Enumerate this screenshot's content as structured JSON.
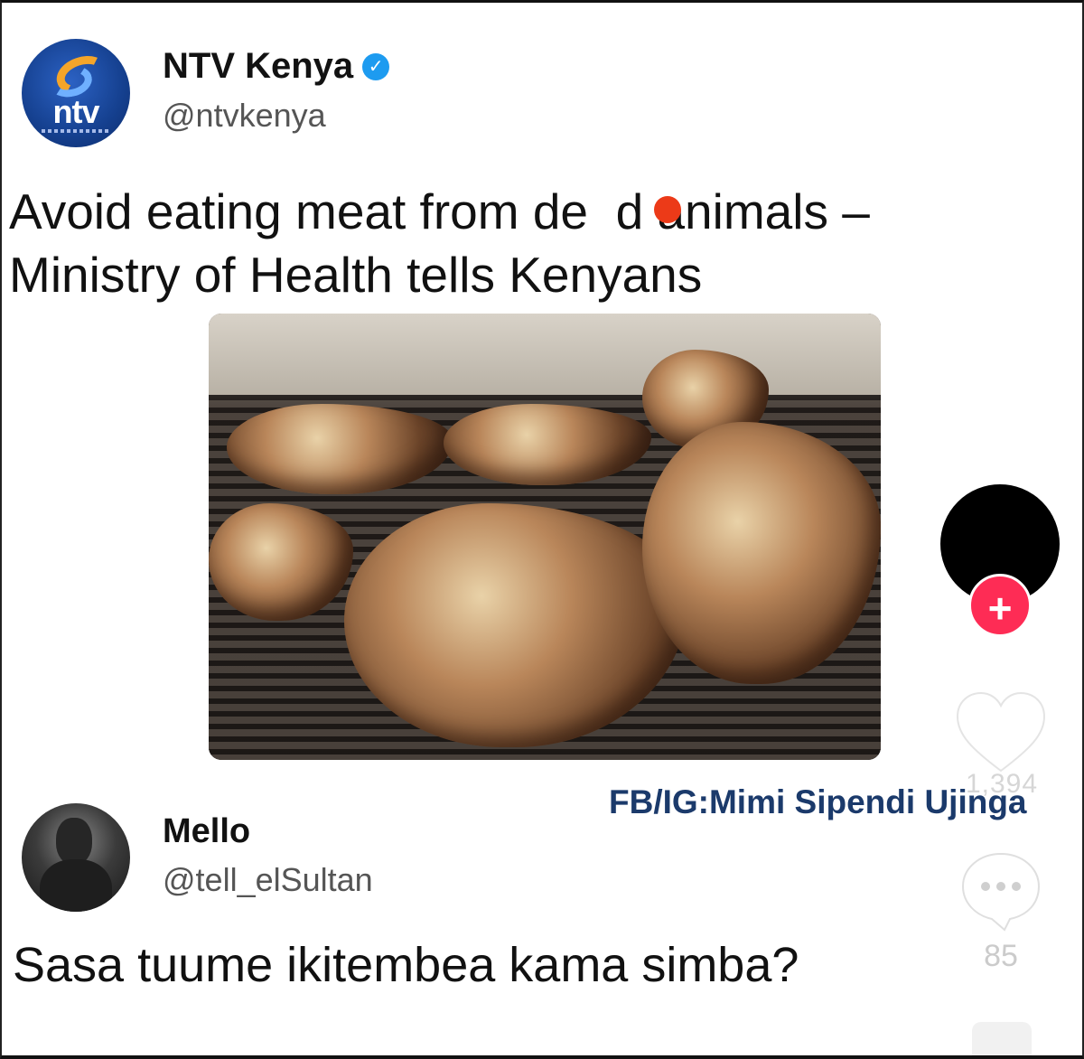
{
  "post": {
    "author_name": "NTV Kenya",
    "author_handle": "@ntvkenya",
    "avatar_logo_text": "ntv",
    "verified_icon": "verified-badge-icon",
    "text_line1": "Avoid eating meat from de  d animals –",
    "text_line2": "Ministry of Health tells Kenyans",
    "image_description_icon": "grilled-meat-photo"
  },
  "watermark": "FB/IG:Mimi Sipendi Ujinga",
  "reply": {
    "author_name": "Mello",
    "author_handle": "@tell_elSultan",
    "text": "Sasa tuume ikitembea kama simba?"
  },
  "side_rail": {
    "follow_label": "+",
    "like_count": "1,394",
    "comment_count": "85",
    "colors": {
      "follow": "#fe2c55",
      "icon": "#ffffff"
    }
  }
}
